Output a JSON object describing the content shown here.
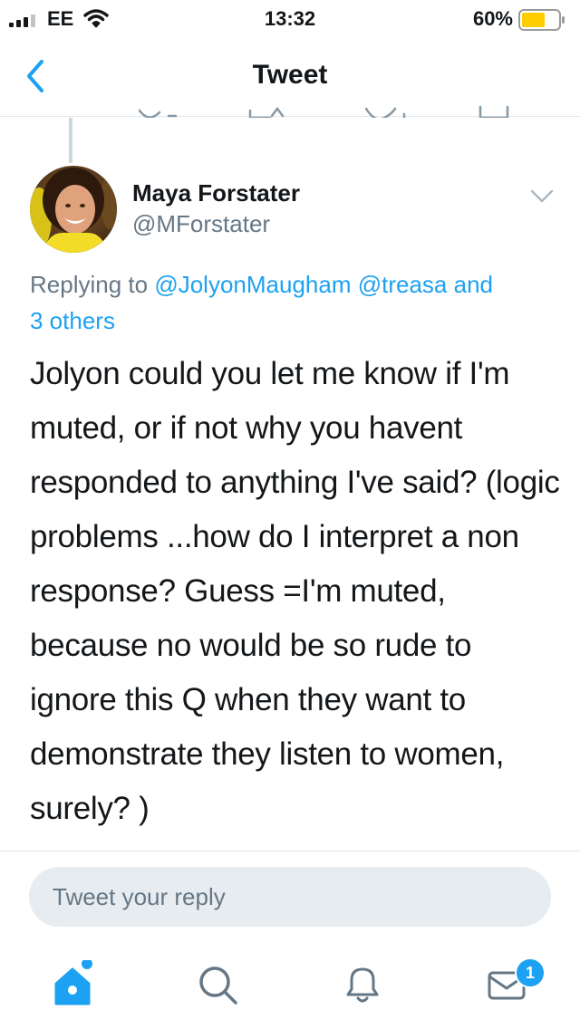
{
  "status_bar": {
    "carrier": "EE",
    "time": "13:32",
    "battery": "60%",
    "battery_level": 0.6,
    "icons": [
      "signal-icon",
      "wifi-icon",
      "battery-icon"
    ]
  },
  "header": {
    "title": "Tweet",
    "back_icon": "chevron-left-icon"
  },
  "tweet": {
    "author_name": "Maya Forstater",
    "author_handle": "@MForstater",
    "replying_prefix": "Replying to",
    "mention_1": "@JolyonMaugham",
    "mention_2": "@treasa",
    "and_word": "and",
    "others": "3 others",
    "text": "Jolyon could you let me know if I'm muted, or if not why you havent responded to anything I've said? (logic problems ...how do I interpret a non response? Guess =I'm muted, because no would be so rude to ignore this Q when they want to demonstrate they listen to women, surely? )"
  },
  "reply": {
    "placeholder": "Tweet your reply"
  },
  "tab_bar": {
    "items": [
      "home-icon",
      "search-icon",
      "bell-icon",
      "mail-icon"
    ],
    "messages_badge": "1"
  },
  "colors": {
    "accent": "#1da1f2",
    "muted_text": "#657786",
    "battery_fill": "#ffcc00"
  }
}
